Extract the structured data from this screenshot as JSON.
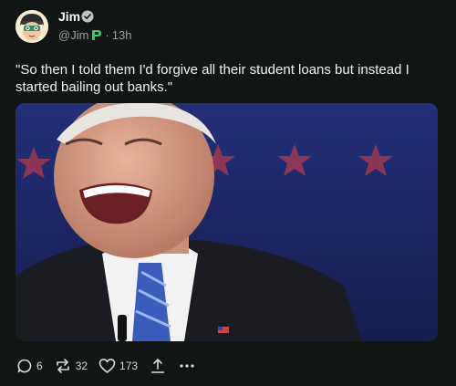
{
  "post": {
    "author_name": "Jim",
    "handle": "@Jim",
    "separator": "·",
    "time": "13h",
    "text": "\"So then I told them I'd forgive all their student loans but instead I started bailing out banks.\""
  },
  "icons": {
    "verified": "verified-badge-icon",
    "platform": "p-badge-icon"
  },
  "actions": {
    "replies": "6",
    "reposts": "32",
    "likes": "173"
  },
  "colors": {
    "background": "#111513",
    "accent_badge": "#2ecc71",
    "stage_blue": "#1b2a6e",
    "star_red": "#b33a4a"
  }
}
